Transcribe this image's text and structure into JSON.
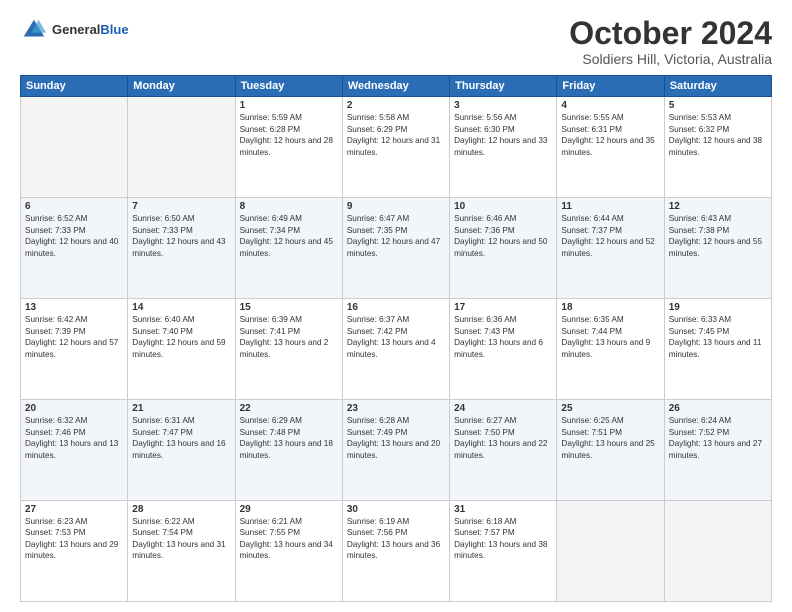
{
  "header": {
    "logo_general": "General",
    "logo_blue": "Blue",
    "month_title": "October 2024",
    "location": "Soldiers Hill, Victoria, Australia"
  },
  "days_of_week": [
    "Sunday",
    "Monday",
    "Tuesday",
    "Wednesday",
    "Thursday",
    "Friday",
    "Saturday"
  ],
  "weeks": [
    [
      {
        "day": "",
        "info": ""
      },
      {
        "day": "",
        "info": ""
      },
      {
        "day": "1",
        "info": "Sunrise: 5:59 AM\nSunset: 6:28 PM\nDaylight: 12 hours and 28 minutes."
      },
      {
        "day": "2",
        "info": "Sunrise: 5:58 AM\nSunset: 6:29 PM\nDaylight: 12 hours and 31 minutes."
      },
      {
        "day": "3",
        "info": "Sunrise: 5:56 AM\nSunset: 6:30 PM\nDaylight: 12 hours and 33 minutes."
      },
      {
        "day": "4",
        "info": "Sunrise: 5:55 AM\nSunset: 6:31 PM\nDaylight: 12 hours and 35 minutes."
      },
      {
        "day": "5",
        "info": "Sunrise: 5:53 AM\nSunset: 6:32 PM\nDaylight: 12 hours and 38 minutes."
      }
    ],
    [
      {
        "day": "6",
        "info": "Sunrise: 6:52 AM\nSunset: 7:33 PM\nDaylight: 12 hours and 40 minutes."
      },
      {
        "day": "7",
        "info": "Sunrise: 6:50 AM\nSunset: 7:33 PM\nDaylight: 12 hours and 43 minutes."
      },
      {
        "day": "8",
        "info": "Sunrise: 6:49 AM\nSunset: 7:34 PM\nDaylight: 12 hours and 45 minutes."
      },
      {
        "day": "9",
        "info": "Sunrise: 6:47 AM\nSunset: 7:35 PM\nDaylight: 12 hours and 47 minutes."
      },
      {
        "day": "10",
        "info": "Sunrise: 6:46 AM\nSunset: 7:36 PM\nDaylight: 12 hours and 50 minutes."
      },
      {
        "day": "11",
        "info": "Sunrise: 6:44 AM\nSunset: 7:37 PM\nDaylight: 12 hours and 52 minutes."
      },
      {
        "day": "12",
        "info": "Sunrise: 6:43 AM\nSunset: 7:38 PM\nDaylight: 12 hours and 55 minutes."
      }
    ],
    [
      {
        "day": "13",
        "info": "Sunrise: 6:42 AM\nSunset: 7:39 PM\nDaylight: 12 hours and 57 minutes."
      },
      {
        "day": "14",
        "info": "Sunrise: 6:40 AM\nSunset: 7:40 PM\nDaylight: 12 hours and 59 minutes."
      },
      {
        "day": "15",
        "info": "Sunrise: 6:39 AM\nSunset: 7:41 PM\nDaylight: 13 hours and 2 minutes."
      },
      {
        "day": "16",
        "info": "Sunrise: 6:37 AM\nSunset: 7:42 PM\nDaylight: 13 hours and 4 minutes."
      },
      {
        "day": "17",
        "info": "Sunrise: 6:36 AM\nSunset: 7:43 PM\nDaylight: 13 hours and 6 minutes."
      },
      {
        "day": "18",
        "info": "Sunrise: 6:35 AM\nSunset: 7:44 PM\nDaylight: 13 hours and 9 minutes."
      },
      {
        "day": "19",
        "info": "Sunrise: 6:33 AM\nSunset: 7:45 PM\nDaylight: 13 hours and 11 minutes."
      }
    ],
    [
      {
        "day": "20",
        "info": "Sunrise: 6:32 AM\nSunset: 7:46 PM\nDaylight: 13 hours and 13 minutes."
      },
      {
        "day": "21",
        "info": "Sunrise: 6:31 AM\nSunset: 7:47 PM\nDaylight: 13 hours and 16 minutes."
      },
      {
        "day": "22",
        "info": "Sunrise: 6:29 AM\nSunset: 7:48 PM\nDaylight: 13 hours and 18 minutes."
      },
      {
        "day": "23",
        "info": "Sunrise: 6:28 AM\nSunset: 7:49 PM\nDaylight: 13 hours and 20 minutes."
      },
      {
        "day": "24",
        "info": "Sunrise: 6:27 AM\nSunset: 7:50 PM\nDaylight: 13 hours and 22 minutes."
      },
      {
        "day": "25",
        "info": "Sunrise: 6:25 AM\nSunset: 7:51 PM\nDaylight: 13 hours and 25 minutes."
      },
      {
        "day": "26",
        "info": "Sunrise: 6:24 AM\nSunset: 7:52 PM\nDaylight: 13 hours and 27 minutes."
      }
    ],
    [
      {
        "day": "27",
        "info": "Sunrise: 6:23 AM\nSunset: 7:53 PM\nDaylight: 13 hours and 29 minutes."
      },
      {
        "day": "28",
        "info": "Sunrise: 6:22 AM\nSunset: 7:54 PM\nDaylight: 13 hours and 31 minutes."
      },
      {
        "day": "29",
        "info": "Sunrise: 6:21 AM\nSunset: 7:55 PM\nDaylight: 13 hours and 34 minutes."
      },
      {
        "day": "30",
        "info": "Sunrise: 6:19 AM\nSunset: 7:56 PM\nDaylight: 13 hours and 36 minutes."
      },
      {
        "day": "31",
        "info": "Sunrise: 6:18 AM\nSunset: 7:57 PM\nDaylight: 13 hours and 38 minutes."
      },
      {
        "day": "",
        "info": ""
      },
      {
        "day": "",
        "info": ""
      }
    ]
  ]
}
